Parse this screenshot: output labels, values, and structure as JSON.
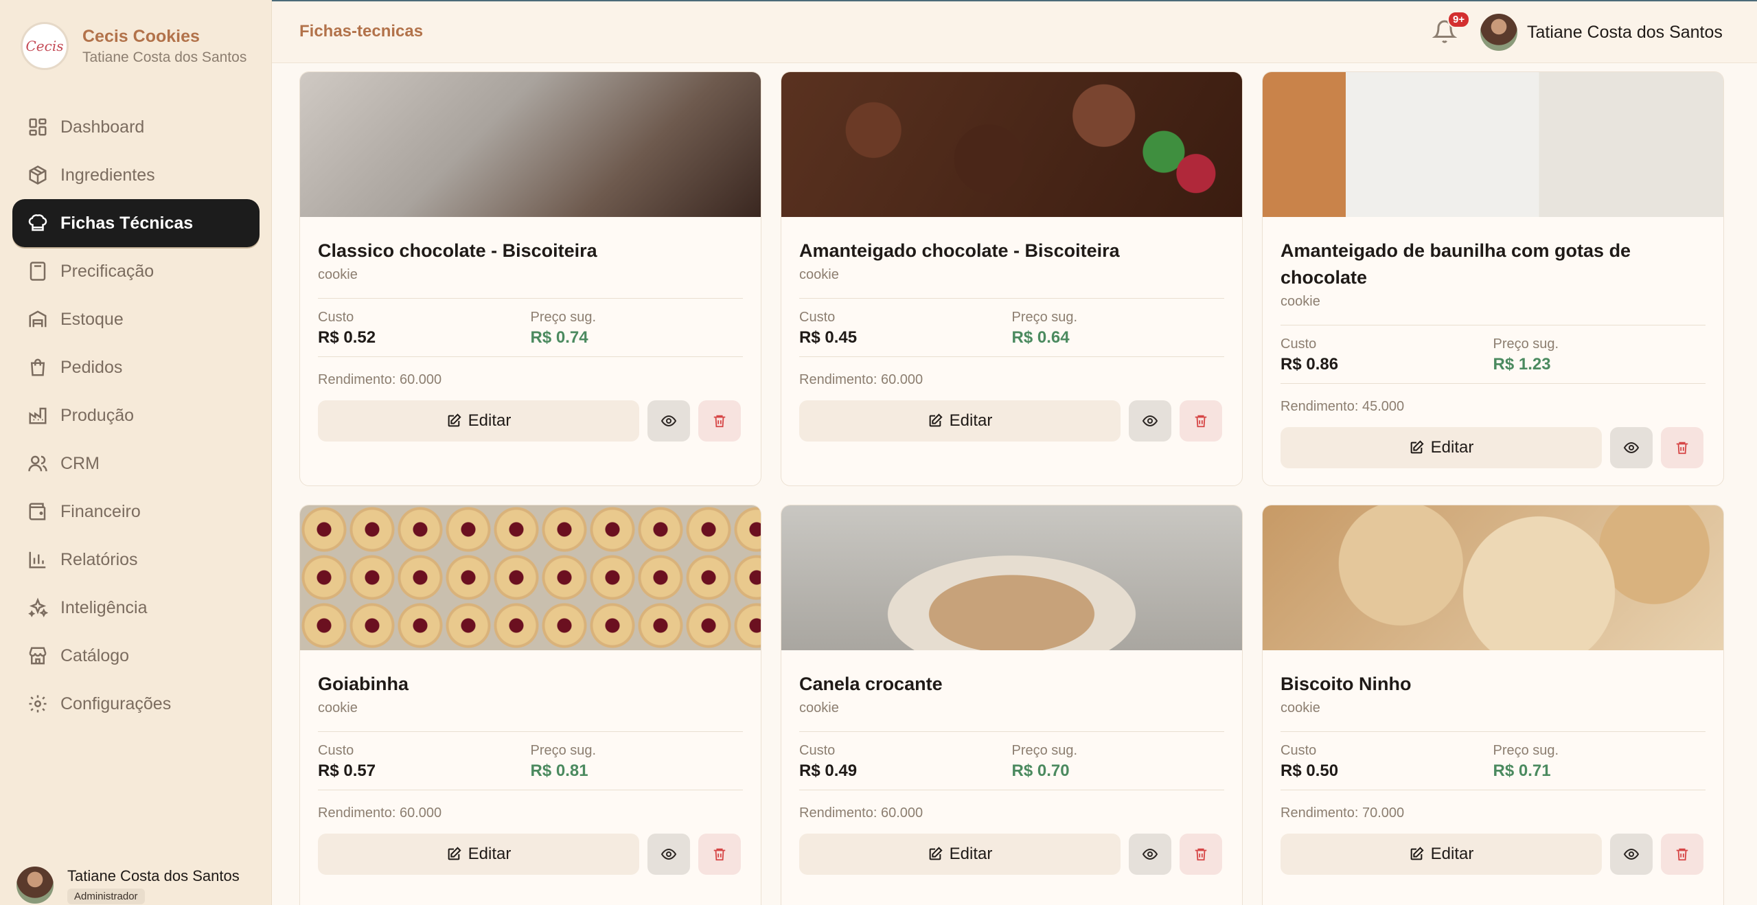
{
  "brand": {
    "logo_text": "Cecis",
    "name": "Cecis Cookies",
    "user": "Tatiane Costa dos Santos"
  },
  "header": {
    "title": "Fichas-tecnicas",
    "notifications": "9+",
    "user_name": "Tatiane Costa dos Santos"
  },
  "nav": [
    {
      "label": "Dashboard",
      "icon": "dashboard-icon"
    },
    {
      "label": "Ingredientes",
      "icon": "package-icon"
    },
    {
      "label": "Fichas Técnicas",
      "icon": "chef-hat-icon",
      "active": true
    },
    {
      "label": "Precificação",
      "icon": "calculator-icon"
    },
    {
      "label": "Estoque",
      "icon": "warehouse-icon"
    },
    {
      "label": "Pedidos",
      "icon": "shopping-bag-icon"
    },
    {
      "label": "Produção",
      "icon": "factory-icon"
    },
    {
      "label": "CRM",
      "icon": "users-icon"
    },
    {
      "label": "Financeiro",
      "icon": "wallet-icon"
    },
    {
      "label": "Relatórios",
      "icon": "bar-chart-icon"
    },
    {
      "label": "Inteligência",
      "icon": "sparkles-icon"
    },
    {
      "label": "Catálogo",
      "icon": "store-icon"
    },
    {
      "label": "Configurações",
      "icon": "gear-icon"
    }
  ],
  "side_user": {
    "name": "Tatiane Costa dos Santos",
    "role": "Administrador"
  },
  "labels": {
    "cost": "Custo",
    "suggested_price": "Preço sug.",
    "edit": "Editar"
  },
  "cards": [
    {
      "title": "Classico chocolate - Biscoiteira",
      "category": "cookie",
      "cost": "R$ 0.52",
      "price": "R$ 0.74",
      "yield": "Rendimento: 60.000"
    },
    {
      "title": "Amanteigado chocolate - Biscoiteira",
      "category": "cookie",
      "cost": "R$ 0.45",
      "price": "R$ 0.64",
      "yield": "Rendimento: 60.000"
    },
    {
      "title": "Amanteigado de baunilha com gotas de chocolate",
      "category": "cookie",
      "cost": "R$ 0.86",
      "price": "R$ 1.23",
      "yield": "Rendimento: 45.000"
    },
    {
      "title": "Goiabinha",
      "category": "cookie",
      "cost": "R$ 0.57",
      "price": "R$ 0.81",
      "yield": "Rendimento: 60.000"
    },
    {
      "title": "Canela crocante",
      "category": "cookie",
      "cost": "R$ 0.49",
      "price": "R$ 0.70",
      "yield": "Rendimento: 60.000"
    },
    {
      "title": "Biscoito Ninho",
      "category": "cookie",
      "cost": "R$ 0.50",
      "price": "R$ 0.71",
      "yield": "Rendimento: 70.000"
    }
  ],
  "colors": {
    "accent": "#b2724a",
    "active_nav": "#1c1c1c",
    "price_green": "#4b8a5f",
    "danger": "#d64545"
  }
}
